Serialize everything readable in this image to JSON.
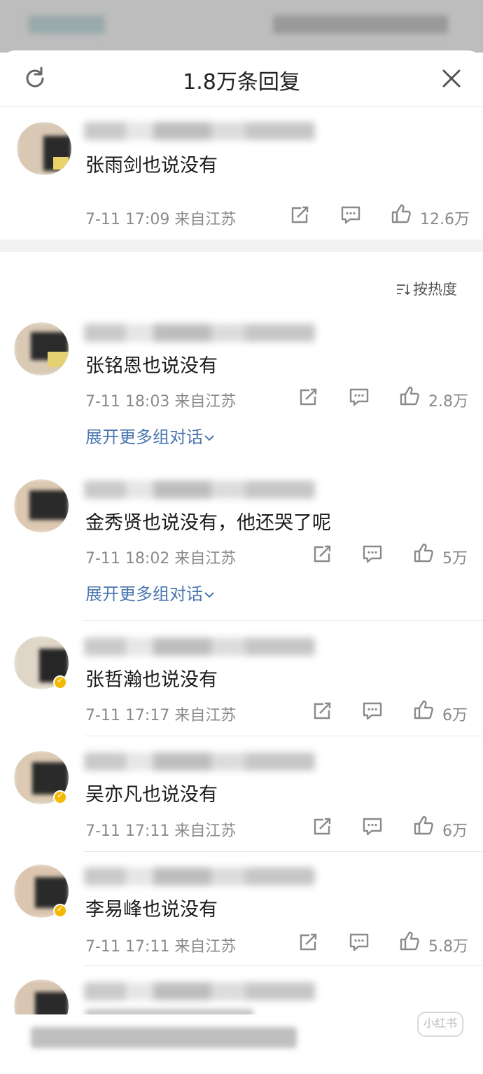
{
  "sheet": {
    "title": "1.8万条回复"
  },
  "sort": {
    "label": "按热度"
  },
  "pinned": {
    "text": "张雨剑也说没有",
    "date": "7-11 17:09",
    "location": "来自江苏",
    "likes": "12.6万"
  },
  "comments": [
    {
      "text": "张铭恩也说没有",
      "date": "7-11 18:03",
      "location": "来自江苏",
      "likes": "2.8万",
      "expand": "展开更多组对话"
    },
    {
      "text": "金秀贤也说没有，他还哭了呢",
      "date": "7-11 18:02",
      "location": "来自江苏",
      "likes": "5万",
      "expand": "展开更多组对话"
    },
    {
      "text": "张哲瀚也说没有",
      "date": "7-11 17:17",
      "location": "来自江苏",
      "likes": "6万"
    },
    {
      "text": "吴亦凡也说没有",
      "date": "7-11 17:11",
      "location": "来自江苏",
      "likes": "6万"
    },
    {
      "text": "李易峰也说没有",
      "date": "7-11 17:11",
      "location": "来自江苏",
      "likes": "5.8万"
    }
  ],
  "watermark": {
    "badge": "小红书"
  },
  "colors": {
    "link": "#4a76b0",
    "meta": "#8a8a8a",
    "badge": "#f5b800"
  },
  "icons": [
    "refresh-icon",
    "close-icon",
    "share-icon",
    "comment-icon",
    "like-icon",
    "sort-icon",
    "chevron-down-icon",
    "verified-badge-icon"
  ]
}
